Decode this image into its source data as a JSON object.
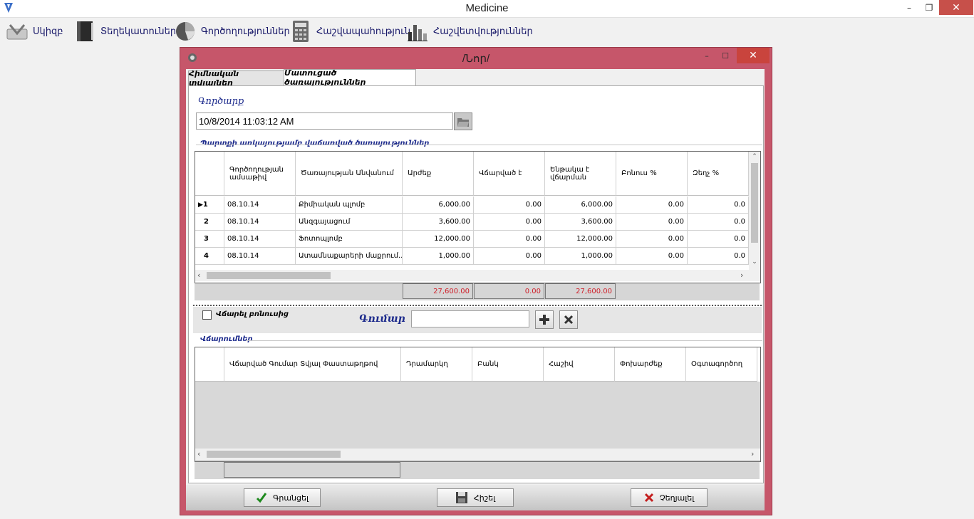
{
  "window": {
    "title": "Medicine",
    "minimize": "–",
    "maximize": "❐",
    "close": "✕"
  },
  "toolbar": [
    {
      "label": "Սկիզբ",
      "icon": "start-icon"
    },
    {
      "label": "Տեղեկատուներ",
      "icon": "book-icon"
    },
    {
      "label": "Գործողություններ",
      "icon": "pie-chart-icon"
    },
    {
      "label": "Հաշվապահություն",
      "icon": "calculator-icon"
    },
    {
      "label": "Հաշվետվություններ",
      "icon": "bar-chart-icon"
    }
  ],
  "dialog": {
    "title": "/Նոր/",
    "min": "–",
    "max": "☐",
    "close": "✕"
  },
  "tabs": [
    {
      "label": "Հիմնական տվյալներ",
      "active": false
    },
    {
      "label": "Մատուցած ծառայություններ",
      "active": true
    }
  ],
  "operation": {
    "label": "Գործարք",
    "value": "10/8/2014 11:03:12 AM"
  },
  "services": {
    "group_label": "Պարտքի առկայությամբ վաճառված ծառայություններ",
    "columns": [
      "Գործողության ամսաթիվ",
      "Ծառայության Անվանում",
      "Արժեք",
      "Վճարված է",
      "Ենթակա է վճարման",
      "Բոնուս %",
      "Զեղչ %"
    ],
    "rows": [
      {
        "num": "1",
        "date": "08.10.14",
        "name": "Քիմիական պլոմբ",
        "price": "6,000.00",
        "paid": "0.00",
        "due": "6,000.00",
        "bonus": "0.00",
        "discount": "0.0"
      },
      {
        "num": "2",
        "date": "08.10.14",
        "name": "Անզգայացում",
        "price": "3,600.00",
        "paid": "0.00",
        "due": "3,600.00",
        "bonus": "0.00",
        "discount": "0.0"
      },
      {
        "num": "3",
        "date": "08.10.14",
        "name": "Ֆոտոպլոմբ",
        "price": "12,000.00",
        "paid": "0.00",
        "due": "12,000.00",
        "bonus": "0.00",
        "discount": "0.0"
      },
      {
        "num": "4",
        "date": "08.10.14",
        "name": "Ատամնաքարերի մաքրում...",
        "price": "1,000.00",
        "paid": "0.00",
        "due": "1,000.00",
        "bonus": "0.00",
        "discount": "0.0"
      }
    ],
    "totals": {
      "price": "27,600.00",
      "paid": "0.00",
      "due": "27,600.00"
    }
  },
  "pay_bonus": {
    "label": "Վճարել բոնուսից"
  },
  "amount": {
    "label": "Գումար",
    "value": ""
  },
  "payments": {
    "group_label": "Վճարումներ",
    "columns": [
      "Վճարված Գումար Տվյալ Փաստաթղթով",
      "Դրամարկղ",
      "Բանկ",
      "Հաշիվ",
      "Փոխարժեք",
      "Օգտագործող"
    ]
  },
  "buttons": {
    "save": "Գրանցել",
    "print": "Հիշել",
    "cancel": "Չեղյալել"
  },
  "colors": {
    "total_text": "#d0202a",
    "accent_blue": "#1c2a8c",
    "dialog_border": "#c6566a"
  }
}
